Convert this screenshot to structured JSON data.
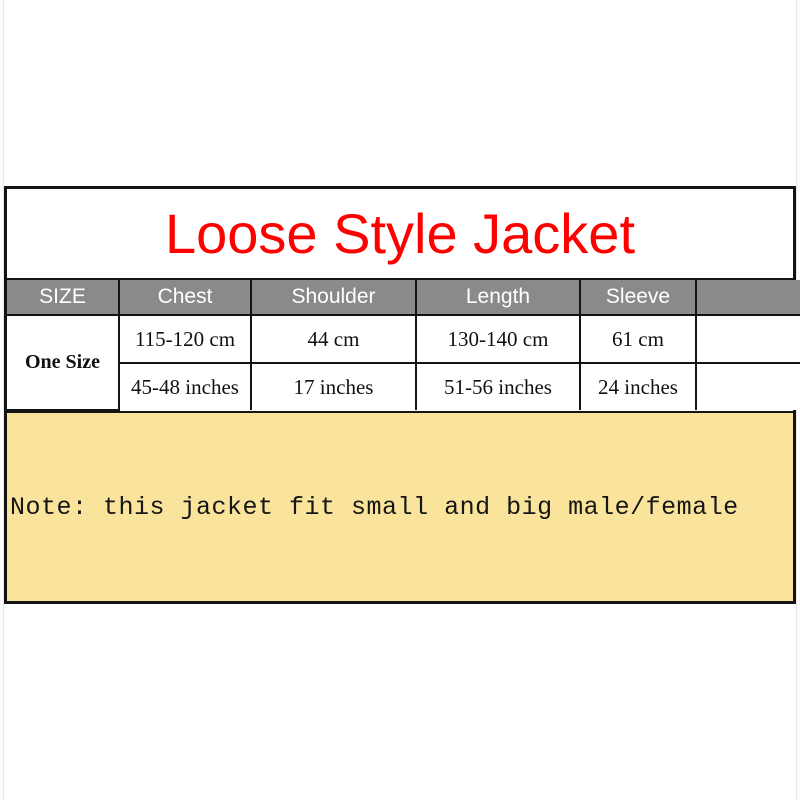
{
  "card": {
    "title": "Loose Style Jacket",
    "title_color": "#fe0000",
    "border_color": "#141414",
    "background": "#ffffff"
  },
  "table": {
    "header_background": "#8a8a8a",
    "header_text_color": "#ffffff",
    "columns": [
      {
        "label": "SIZE"
      },
      {
        "label": "Chest"
      },
      {
        "label": "Shoulder"
      },
      {
        "label": "Length"
      },
      {
        "label": "Sleeve"
      },
      {
        "label": ""
      }
    ],
    "size_label": "One Size",
    "rows": [
      {
        "unit": "cm",
        "cells": [
          "115-120 cm",
          "44 cm",
          "130-140 cm",
          "61 cm",
          ""
        ]
      },
      {
        "unit": "inches",
        "cells": [
          "45-48 inches",
          "17 inches",
          "51-56 inches",
          "24 inches",
          ""
        ]
      }
    ]
  },
  "note": {
    "text": "Note: this jacket fit small and big male/female",
    "background": "#fae49b"
  }
}
